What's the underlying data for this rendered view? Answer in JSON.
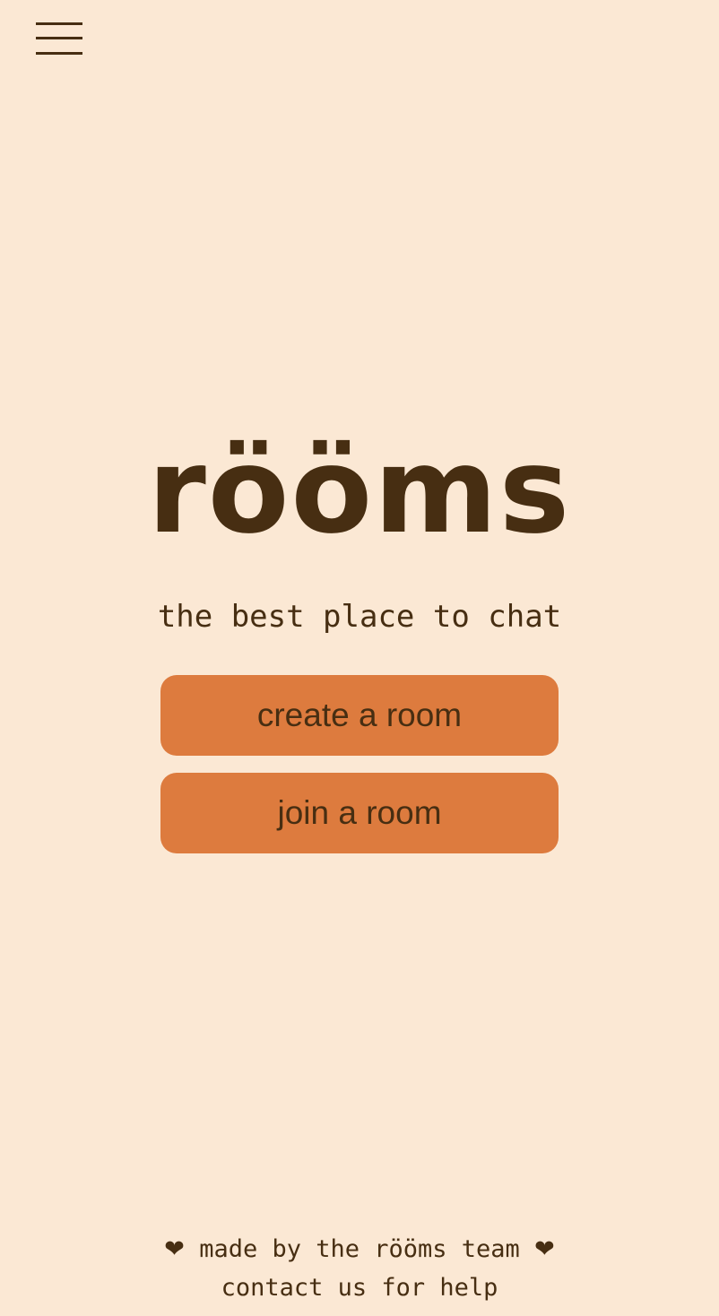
{
  "header": {
    "menu_icon": "hamburger-menu-icon"
  },
  "hero": {
    "logo_text": "rööms",
    "tagline": "the best place to chat"
  },
  "actions": {
    "create_label": "create a room",
    "join_label": "join a room"
  },
  "footer": {
    "heart_icon": "heart-icon",
    "heart_glyph": "❤",
    "made_by_text": "made by the rööms team",
    "contact_text": "contact us for help"
  },
  "colors": {
    "background": "#fbe8d4",
    "text": "#472e12",
    "button": "#dd7b3e"
  }
}
